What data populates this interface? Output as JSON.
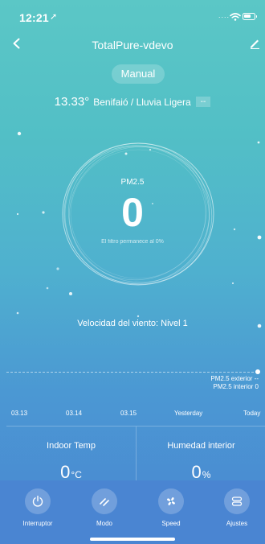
{
  "status_bar": {
    "time": "12:21",
    "location_arrow": "➚",
    "signal_dots": "....",
    "wifi_icon": "wifi-icon",
    "battery_icon": "battery-icon"
  },
  "header": {
    "title": "TotalPure-vdevo",
    "back_icon": "back-chevron-icon",
    "edit_icon": "edit-pencil-icon"
  },
  "mode": {
    "label": "Manual"
  },
  "weather": {
    "temperature": "13.33°",
    "location_condition": "Benifaió / Lluvia Ligera",
    "aqi_badge": "--"
  },
  "gauge": {
    "label": "PM2.5",
    "value": "0",
    "filter_text": "El filtro permanece al 0%"
  },
  "wind": {
    "text": "Velocidad del viento: Nivel 1"
  },
  "chart": {
    "legend": [
      "PM2.5 exterior --",
      "PM2.5 interior 0"
    ],
    "dates": [
      "03.13",
      "03.14",
      "03.15",
      "Yesterday",
      "Today"
    ]
  },
  "stats": {
    "indoor_temp": {
      "label": "Indoor Temp",
      "value": "0",
      "unit": "°C"
    },
    "humidity": {
      "label": "Humedad interior",
      "value": "0",
      "unit": "%"
    }
  },
  "tabs": [
    {
      "label": "Interruptor",
      "icon": "power-icon"
    },
    {
      "label": "Modo",
      "icon": "mode-icon"
    },
    {
      "label": "Speed",
      "icon": "fan-icon"
    },
    {
      "label": "Ajustes",
      "icon": "settings-icon"
    }
  ],
  "colors": {
    "bg_top": "#5bc7c6",
    "bg_bottom": "#4a86d2",
    "tabbar": "#4a85d2",
    "text": "#ffffff"
  }
}
